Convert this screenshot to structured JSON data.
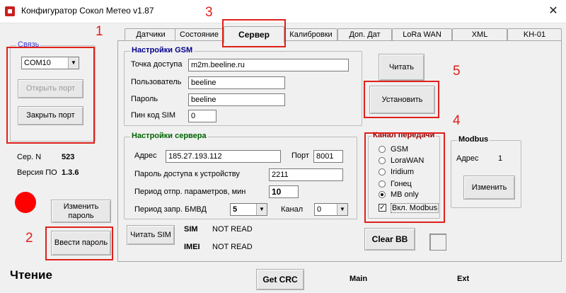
{
  "window": {
    "title": "Конфигуратор Сокол Метео v1.87",
    "close_glyph": "✕"
  },
  "left": {
    "connection_group": "Связь",
    "port_value": "COM10",
    "open_port": "Открыть порт",
    "close_port": "Закрыть порт",
    "serial_label": "Сер. N",
    "serial_value": "523",
    "fw_label": "Версия ПО",
    "fw_value": "1.3.6",
    "status_color": "#ff0000",
    "change_password": "Изменить пароль",
    "enter_password": "Ввести пароль",
    "read_status": "Чтение"
  },
  "tabs": [
    {
      "label": "Датчики"
    },
    {
      "label": "Состояние"
    },
    {
      "label": "Сервер"
    },
    {
      "label": "Калибровки"
    },
    {
      "label": "Доп. Дат"
    },
    {
      "label": "LoRa WAN"
    },
    {
      "label": "XML"
    },
    {
      "label": "KH-01"
    }
  ],
  "gsm": {
    "title": "Настройки GSM",
    "title_color": "#00008b",
    "apn_label": "Точка доступа",
    "apn_value": "m2m.beeline.ru",
    "user_label": "Пользователь",
    "user_value": "beeline",
    "pass_label": "Пароль",
    "pass_value": "beeline",
    "pin_label": "Пин код SIM",
    "pin_value": "0"
  },
  "server": {
    "title": "Настройки сервера",
    "title_color": "#006400",
    "addr_label": "Адрес",
    "addr_value": "185.27.193.112",
    "port_label": "Порт",
    "port_value": "8001",
    "devpass_label": "Пароль доступа к устройству",
    "devpass_value": "2211",
    "period_send_label": "Период отпр. параметров, мин",
    "period_send_value": "10",
    "period_req_label": "Период запр. БМВД",
    "period_req_value": "5",
    "channel_label": "Канал",
    "channel_value": "0"
  },
  "buttons": {
    "read": "Читать",
    "set": "Установить",
    "read_sim": "Читать SIM",
    "clear_bb": "Clear BB",
    "change": "Изменить",
    "get_crc": "Get CRC"
  },
  "channel": {
    "title": "Канал передачи",
    "title_color": "#8b0000",
    "options": [
      "GSM",
      "LoraWAN",
      "Iridium",
      "Гонец",
      "MB only"
    ],
    "selected_index": 4,
    "modbus_check_label": "Вкл. Modbus",
    "modbus_check_mark": "✓"
  },
  "modbus": {
    "title": "Modbus",
    "addr_label": "Адрес",
    "addr_value": "1"
  },
  "sim": {
    "sim_label": "SIM",
    "sim_value": "NOT READ",
    "imei_label": "IMEI",
    "imei_value": "NOT READ"
  },
  "footer": {
    "main": "Main",
    "ext": "Ext"
  },
  "annotations": [
    "1",
    "2",
    "3",
    "4",
    "5"
  ],
  "colors": {
    "annotation": "#e0201a"
  }
}
